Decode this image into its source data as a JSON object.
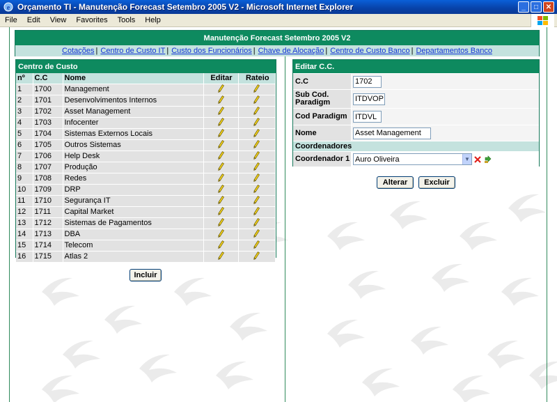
{
  "window": {
    "title": "Orçamento TI - Manutenção Forecast Setembro 2005 V2 - Microsoft Internet Explorer",
    "controls": {
      "minimize": "_",
      "maximize": "□",
      "close": "✕"
    }
  },
  "menu": [
    "File",
    "Edit",
    "View",
    "Favorites",
    "Tools",
    "Help"
  ],
  "header": {
    "title": "Manutenção Forecast Setembro 2005 V2",
    "links": [
      "Cotações",
      "Centro de Custo IT",
      "Custo dos Funcionários",
      "Chave de Alocação",
      "Centro de Custo Banco",
      "Departamentos Banco"
    ],
    "separator": "|"
  },
  "left": {
    "title": "Centro de Custo",
    "columns": {
      "num": "nº",
      "cc": "C.C",
      "name": "Nome",
      "edit": "Editar",
      "rateio": "Rateio"
    },
    "rows": [
      {
        "n": "1",
        "cc": "1700",
        "name": "Management"
      },
      {
        "n": "2",
        "cc": "1701",
        "name": "Desenvolvimentos Internos"
      },
      {
        "n": "3",
        "cc": "1702",
        "name": "Asset Management"
      },
      {
        "n": "4",
        "cc": "1703",
        "name": "Infocenter"
      },
      {
        "n": "5",
        "cc": "1704",
        "name": "Sistemas Externos Locais"
      },
      {
        "n": "6",
        "cc": "1705",
        "name": "Outros Sistemas"
      },
      {
        "n": "7",
        "cc": "1706",
        "name": "Help Desk"
      },
      {
        "n": "8",
        "cc": "1707",
        "name": "Produção"
      },
      {
        "n": "9",
        "cc": "1708",
        "name": "Redes"
      },
      {
        "n": "10",
        "cc": "1709",
        "name": "DRP"
      },
      {
        "n": "11",
        "cc": "1710",
        "name": "Segurança IT"
      },
      {
        "n": "12",
        "cc": "1711",
        "name": "Capital Market"
      },
      {
        "n": "13",
        "cc": "1712",
        "name": "Sistemas de Pagamentos"
      },
      {
        "n": "14",
        "cc": "1713",
        "name": "DBA"
      },
      {
        "n": "15",
        "cc": "1714",
        "name": "Telecom"
      },
      {
        "n": "16",
        "cc": "1715",
        "name": "Atlas 2"
      }
    ],
    "include_button": "Incluir"
  },
  "right": {
    "title": "Editar C.C.",
    "fields": {
      "cc": {
        "label": "C.C",
        "value": "1702"
      },
      "subcod": {
        "label": "Sub Cod. Paradigm",
        "value": "ITDVOP"
      },
      "codparadigm": {
        "label": "Cod Paradigm",
        "value": "ITDVL"
      },
      "nome": {
        "label": "Nome",
        "value": "Asset Management"
      }
    },
    "coordinators_section": "Coordenadores",
    "coordinator": {
      "label": "Coordenador 1",
      "value": "Auro Oliveira"
    },
    "alter_button": "Alterar",
    "delete_button": "Excluir"
  },
  "colors": {
    "header_green": "#0e8a5f",
    "light_teal": "#c4e2de",
    "row_gray": "#e2e2e2",
    "link_blue": "#1433d6"
  }
}
